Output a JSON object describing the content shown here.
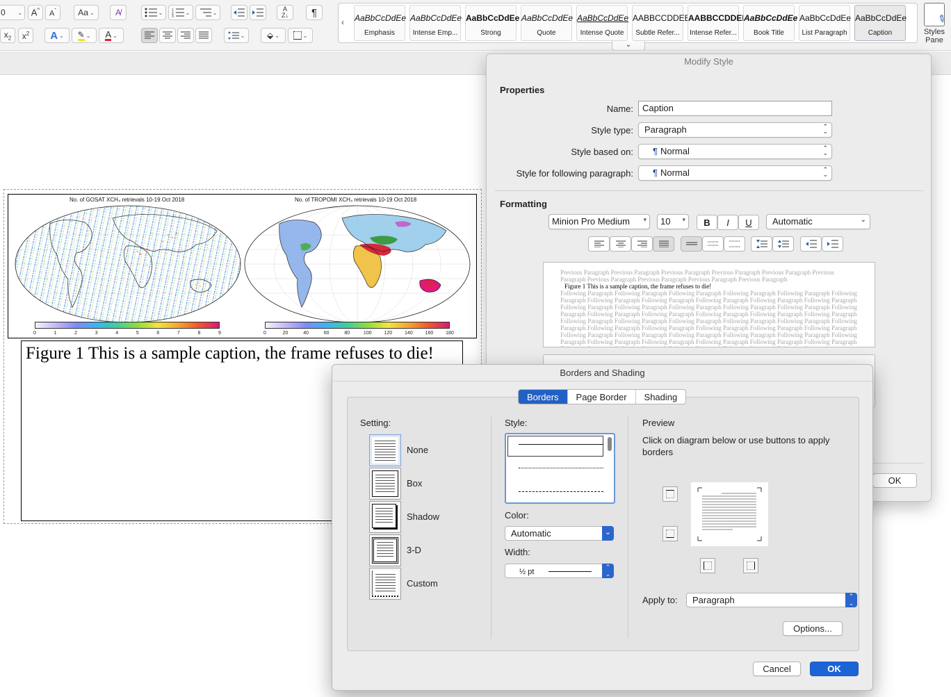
{
  "ribbon": {
    "font_size_value": "0",
    "change_case_label": "Aa",
    "styles_more_label": "⌄",
    "gallery_prev": "‹",
    "gallery": [
      {
        "sample": "AaBbCcDdEe",
        "name": "Emphasis",
        "cls": "s-emph"
      },
      {
        "sample": "AaBbCcDdEe",
        "name": "Intense Emp...",
        "cls": "s-iemph"
      },
      {
        "sample": "AaBbCcDdEe",
        "name": "Strong",
        "cls": "s-strong"
      },
      {
        "sample": "AaBbCcDdEe",
        "name": "Quote",
        "cls": "s-quote"
      },
      {
        "sample": "AaBbCcDdEe",
        "name": "Intense Quote",
        "cls": "s-iquote"
      },
      {
        "sample": "AABBCCDDEE",
        "name": "Subtle Refer...",
        "cls": "s-subref"
      },
      {
        "sample": "AABBCCDDEE",
        "name": "Intense Refer...",
        "cls": "s-iref"
      },
      {
        "sample": "AaBbCcDdEe",
        "name": "Book Title",
        "cls": "s-book"
      },
      {
        "sample": "AaBbCcDdEe",
        "name": "List Paragraph",
        "cls": ""
      },
      {
        "sample": "AaBbCcDdEe",
        "name": "Caption",
        "cls": "s-cap"
      }
    ],
    "styles_pane_label_1": "Styles",
    "styles_pane_label_2": "Pane"
  },
  "document": {
    "map1_title": "No. of GOSAT XCH₄ retrievals 10-19 Oct 2018",
    "map2_title": "No. of TROPOMI XCH₄ retrievals 10-19 Oct 2018",
    "map1_ticks": [
      "0",
      "1",
      "2",
      "3",
      "4",
      "5",
      "6",
      "7",
      "8",
      "9"
    ],
    "map2_ticks": [
      "0",
      "20",
      "40",
      "60",
      "80",
      "100",
      "120",
      "140",
      "160",
      "180"
    ],
    "caption": "Figure 1 This is a sample caption, the frame refuses to die!"
  },
  "modify_style": {
    "title": "Modify Style",
    "properties_heading": "Properties",
    "name_label": "Name:",
    "name_value": "Caption",
    "style_type_label": "Style type:",
    "style_type_value": "Paragraph",
    "based_on_label": "Style based on:",
    "based_on_value": "Normal",
    "following_label": "Style for following paragraph:",
    "following_value": "Normal",
    "pilcrow": "¶",
    "formatting_heading": "Formatting",
    "font_name": "Minion Pro Medium",
    "font_size": "10",
    "bold_label": "B",
    "italic_label": "I",
    "underline_label": "U",
    "color_value": "Automatic",
    "preview_previous": "Previous Paragraph Previous Paragraph Previous Paragraph Previous Paragraph Previous Paragraph Previous Paragraph Previous Paragraph Previous Paragraph Previous Paragraph Previous Paragraph",
    "preview_current": "Figure 1 This is a sample caption, the frame refuses to die!",
    "preview_following": "Following Paragraph Following Paragraph Following Paragraph Following Paragraph Following Paragraph Following Paragraph Following Paragraph Following Paragraph Following Paragraph Following Paragraph Following Paragraph Following Paragraph Following Paragraph Following Paragraph Following Paragraph Following Paragraph Following Paragraph Following Paragraph Following Paragraph Following Paragraph Following Paragraph Following Paragraph Following Paragraph Following Paragraph Following Paragraph Following Paragraph Following Paragraph Following Paragraph Following Paragraph Following Paragraph Following Paragraph Following Paragraph Following Paragraph Following Paragraph Following Paragraph Following Paragraph Following Paragraph Following Paragraph Following Paragraph Following Paragraph Following Paragraph Following Paragraph Following Paragraph Following Paragraph Following Paragraph Following Paragraph Following Paragraph Following Paragraph Following Paragraph",
    "ok_label": "OK"
  },
  "borders_shading": {
    "title": "Borders and Shading",
    "tabs": [
      "Borders",
      "Page Border",
      "Shading"
    ],
    "active_tab": "Borders",
    "setting_label": "Setting:",
    "settings": [
      "None",
      "Box",
      "Shadow",
      "3-D",
      "Custom"
    ],
    "selected_setting": "None",
    "style_label": "Style:",
    "color_label": "Color:",
    "color_value": "Automatic",
    "width_label": "Width:",
    "width_value": "½ pt",
    "preview_label": "Preview",
    "preview_instructions": "Click on diagram below or use buttons to apply borders",
    "apply_to_label": "Apply to:",
    "apply_to_value": "Paragraph",
    "options_label": "Options...",
    "cancel_label": "Cancel",
    "ok_label": "OK"
  },
  "colors": {
    "accent": "#1c63d6",
    "tab_active": "#2260c4"
  }
}
